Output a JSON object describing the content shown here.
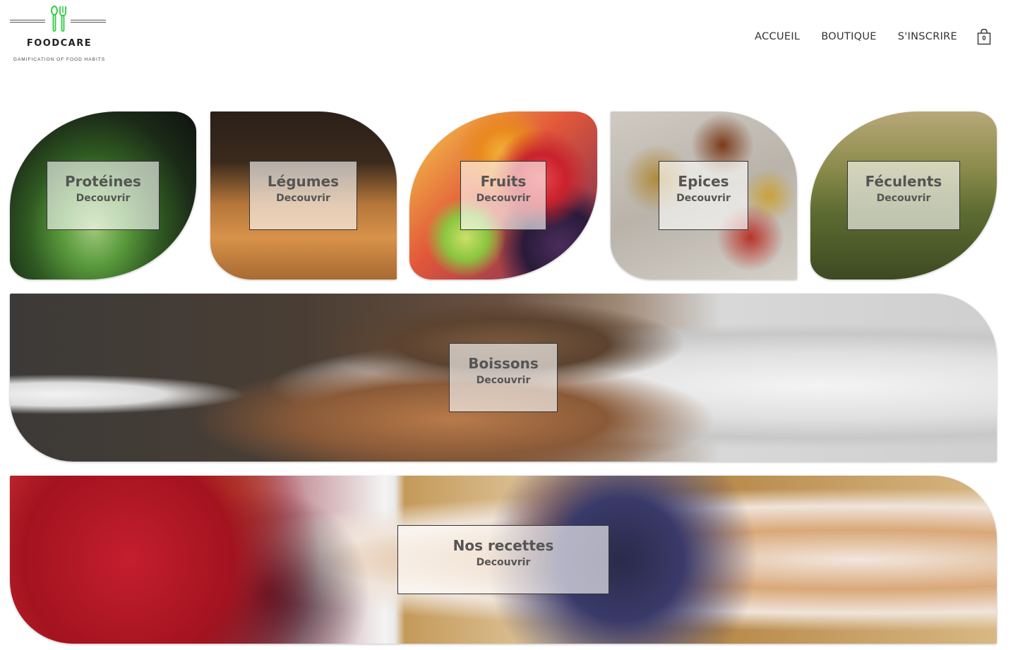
{
  "header": {
    "brand": "FOODCARE",
    "tagline": "GAMIFICATION OF FOOD HABITS",
    "nav": [
      "ACCUEIL",
      "BOUTIQUE",
      "S'INSCRIRE"
    ],
    "cart_count": "0",
    "accent": "#2ecc40"
  },
  "categories": [
    {
      "title": "Protéines",
      "cta": "Decouvrir"
    },
    {
      "title": "Légumes",
      "cta": "Decouvrir"
    },
    {
      "title": "Fruits",
      "cta": "Decouvrir"
    },
    {
      "title": "Epices",
      "cta": "Decouvrir"
    },
    {
      "title": "Féculents",
      "cta": "Decouvrir"
    }
  ],
  "boissons": {
    "title": "Boissons",
    "cta": "Decouvrir"
  },
  "recettes": {
    "title": "Nos recettes",
    "cta": "Decouvrir"
  }
}
